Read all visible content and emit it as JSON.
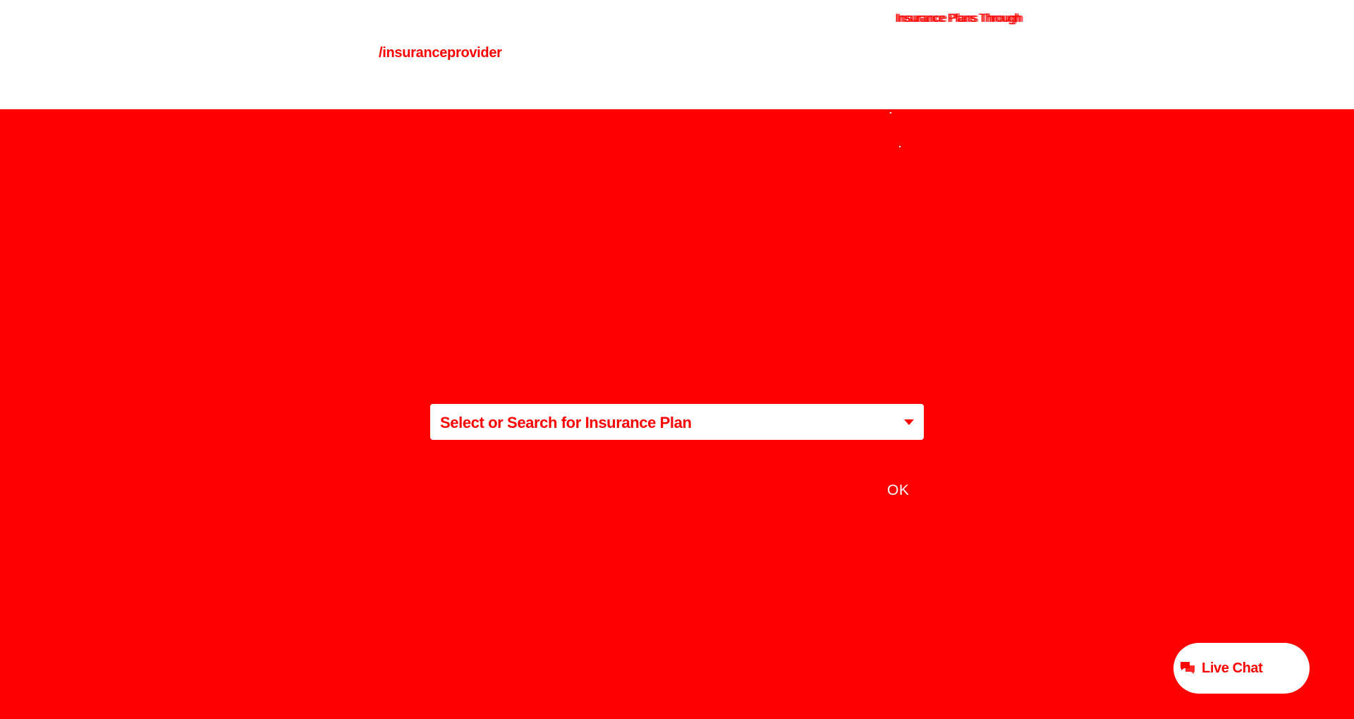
{
  "header": {
    "path": "/insuranceprovider",
    "top_link": "Insurance Plans Through"
  },
  "main": {
    "plan_select_placeholder": "Select or Search for Insurance Plan",
    "ok_label": "OK"
  },
  "chat": {
    "label": "Live Chat",
    "icon": "chat-bubbles-icon"
  },
  "colors": {
    "accent": "#ff0000",
    "background": "#ffffff"
  }
}
